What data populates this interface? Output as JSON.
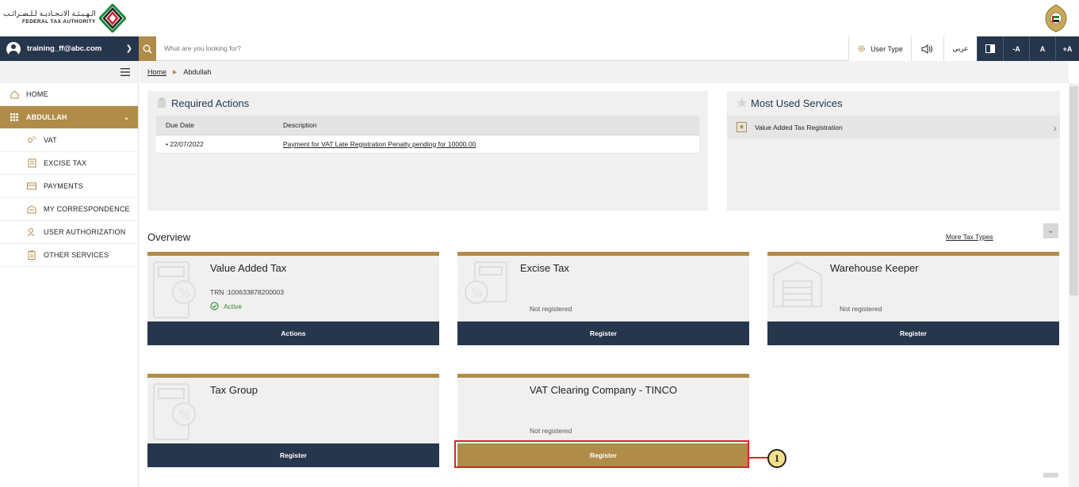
{
  "header": {
    "logo_arabic": "الـهـيـئـة الاتـحـاديـة لـلـضـرائـب",
    "logo_english": "FEDERAL TAX AUTHORITY"
  },
  "topbar": {
    "user_email": "training_ff@abc.com",
    "search_placeholder": "What are you looking for?",
    "user_type": "User Type",
    "arabic": "عربي",
    "font_decrease": "-A",
    "font_normal": "A",
    "font_increase": "+A"
  },
  "sidebar": {
    "items": [
      {
        "label": "HOME",
        "icon": "home-icon"
      },
      {
        "label": "ABDULLAH",
        "icon": "grid-icon"
      },
      {
        "label": "VAT",
        "icon": "vat-icon"
      },
      {
        "label": "EXCISE TAX",
        "icon": "excise-icon"
      },
      {
        "label": "PAYMENTS",
        "icon": "payments-icon"
      },
      {
        "label": "MY CORRESPONDENCE",
        "icon": "correspondence-icon"
      },
      {
        "label": "USER AUTHORIZATION",
        "icon": "user-authorization-icon"
      },
      {
        "label": "OTHER SERVICES",
        "icon": "clipboard-icon"
      }
    ]
  },
  "breadcrumb": {
    "home": "Home",
    "current": "Abdullah"
  },
  "required_actions": {
    "title": "Required Actions",
    "columns": [
      "Due Date",
      "Description"
    ],
    "rows": [
      {
        "due_date": "• 22/07/2022",
        "description": "Payment for VAT Late Registration Penalty pending for 10000.00"
      }
    ]
  },
  "most_used": {
    "title": "Most Used Services",
    "items": [
      "Value Added Tax Registration"
    ]
  },
  "overview": {
    "title": "Overview",
    "more_link": "More Tax Types",
    "cards": [
      {
        "title": "Value Added Tax",
        "trn": "TRN :100633878200003",
        "status": "Active",
        "button": "Actions"
      },
      {
        "title": "Excise Tax",
        "status": "Not registered",
        "button": "Register"
      },
      {
        "title": "Warehouse Keeper",
        "status": "Not registered",
        "button": "Register"
      },
      {
        "title": "Tax Group",
        "button": "Register"
      },
      {
        "title": "VAT Clearing Company - TINCO",
        "status": "Not registered",
        "button": "Register"
      }
    ]
  },
  "annotation": {
    "callout_number": "1",
    "highlight_color": "#e0202a"
  },
  "colors": {
    "navy": "#25364d",
    "gold": "#b08c49",
    "panel": "#f0f0f0"
  }
}
